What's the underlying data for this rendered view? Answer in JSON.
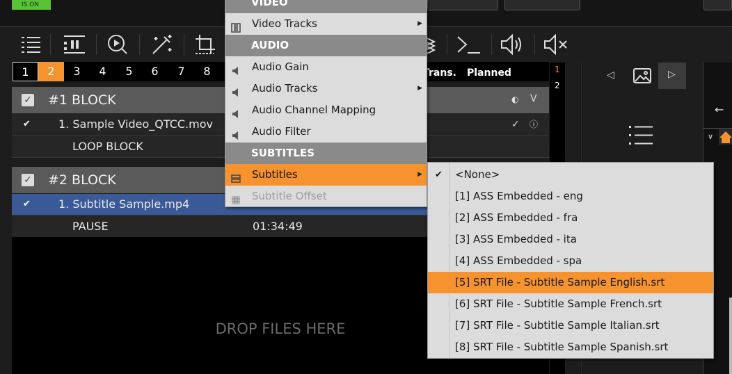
{
  "top": {
    "status_badge": "IS ON"
  },
  "toolbar": {
    "icons": [
      "list-settings-icon",
      "playlist-pause-icon",
      "search-play-icon",
      "magic-wand-icon",
      "crop-icon",
      "layers-icon",
      "terminal-icon",
      "volume-icon",
      "mute-icon"
    ]
  },
  "tabs": [
    "1",
    "2",
    "3",
    "4",
    "5",
    "6",
    "7",
    "8"
  ],
  "columns": {
    "trans": "Trans.",
    "planned": "Planned"
  },
  "playlist": {
    "blocks": [
      {
        "title": "#1 BLOCK",
        "items": [
          {
            "name": "1. Sample Video_QTCC.mov"
          }
        ],
        "footer": "LOOP BLOCK"
      },
      {
        "title": "#2 BLOCK",
        "items": [
          {
            "name": "1. Subtitle Sample.mp4"
          }
        ],
        "footer": "PAUSE",
        "footer_time": "01:34:49"
      }
    ]
  },
  "drop_zone": {
    "text": "DROP FILES HERE"
  },
  "side_numbers": [
    "1",
    "2"
  ],
  "menu": {
    "video_header": "VIDEO",
    "video_tracks": "Video Tracks",
    "audio_header": "AUDIO",
    "audio_gain": "Audio Gain",
    "audio_tracks": "Audio Tracks",
    "audio_channel_mapping": "Audio Channel Mapping",
    "audio_filter": "Audio Filter",
    "subtitles_header": "SUBTITLES",
    "subtitles": "Subtitles",
    "subtitle_offset": "Subtitle Offset"
  },
  "submenu": {
    "items": [
      "<None>",
      "[1] ASS Embedded - eng",
      "[2] ASS Embedded - fra",
      "[3] ASS Embedded - ita",
      "[4] ASS Embedded - spa",
      "[5] SRT File - Subtitle Sample English.srt",
      "[6] SRT File - Subtitle Sample French.srt",
      "[7] SRT File - Subtitle Sample Italian.srt",
      "[8] SRT File - Subtitle Sample Spanish.srt"
    ],
    "checked_index": 0,
    "highlighted_index": 5
  },
  "colors": {
    "accent": "#f7932f",
    "selected_row": "#3a5a97",
    "status_green": "#5bc236"
  }
}
